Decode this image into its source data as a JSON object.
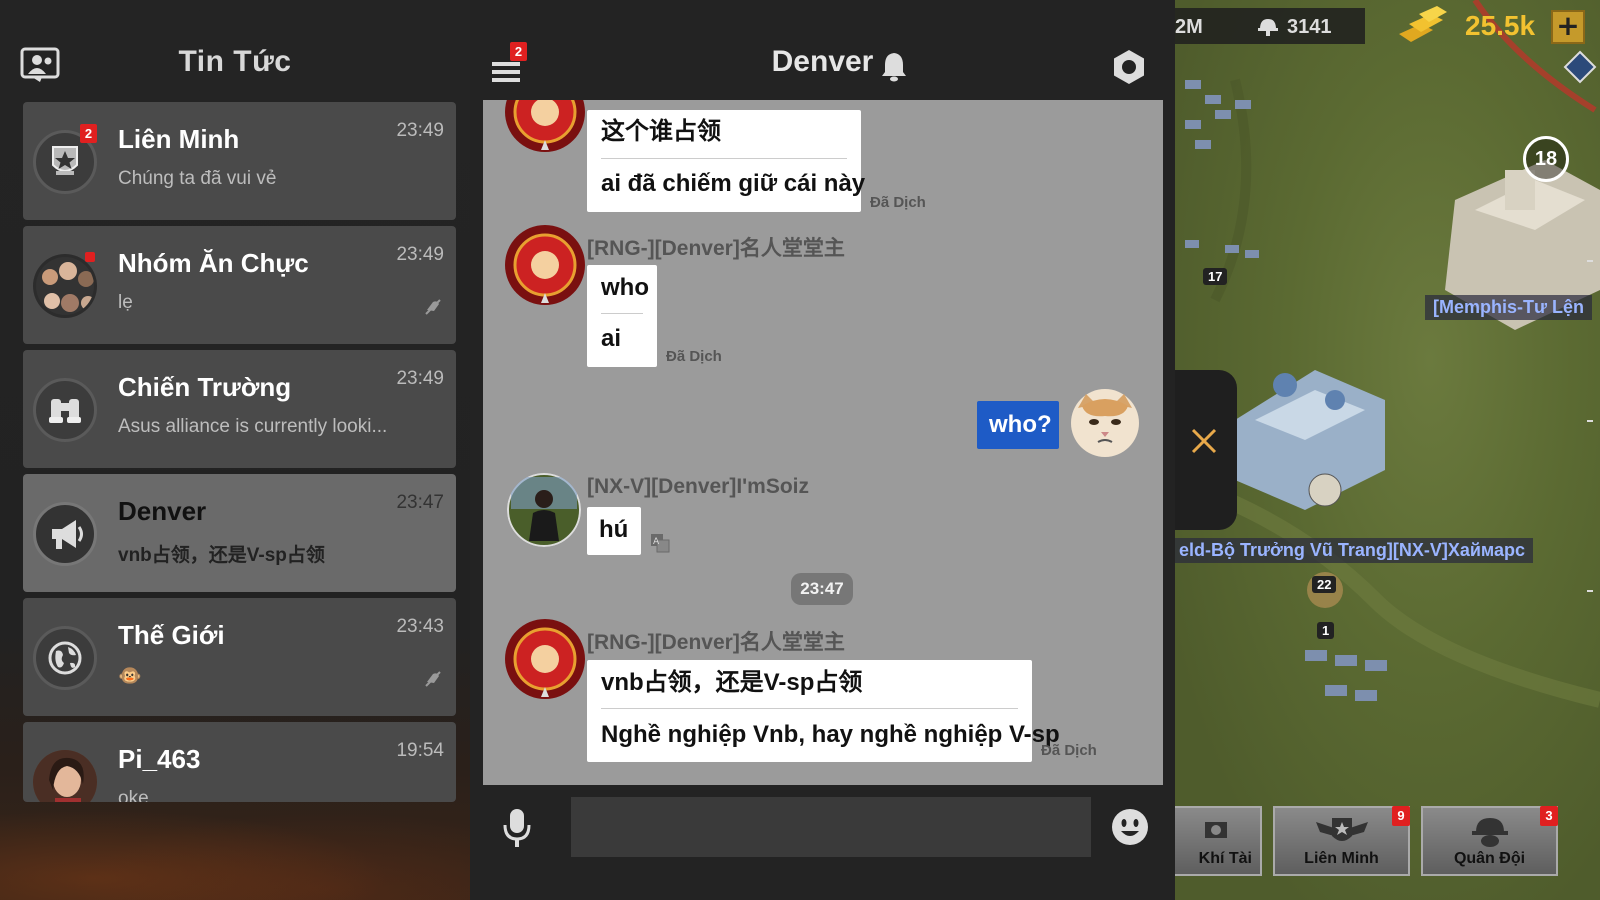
{
  "left_panel": {
    "title": "Tin Tức",
    "conversations": [
      {
        "name": "Liên Minh",
        "preview": "Chúng ta đã vui vẻ",
        "time": "23:49",
        "badge": "2"
      },
      {
        "name": "Nhóm Ăn Chực",
        "preview": "lẹ",
        "time": "23:49"
      },
      {
        "name": "Chiến Trường",
        "preview": "Asus alliance is currently looki...",
        "time": "23:49"
      },
      {
        "name": "Denver",
        "preview": "vnb占领，还是V-sp占领",
        "time": "23:47"
      },
      {
        "name": "Thế Giới",
        "preview": "🐵",
        "time": "23:43"
      },
      {
        "name": "Pi_463",
        "preview": "oke",
        "time": "19:54"
      }
    ]
  },
  "chat": {
    "title": "Denver",
    "menu_badge": "2",
    "messages": [
      {
        "lines": [
          "这个谁占领",
          "ai đã chiếm giữ cái này"
        ],
        "translated": "Đã Dịch"
      },
      {
        "sender": "[RNG-][Denver]名人堂堂主",
        "lines": [
          "who",
          "ai"
        ],
        "translated": "Đã Dịch"
      },
      {
        "own": true,
        "lines": [
          "who?"
        ]
      },
      {
        "sender": "[NX-V][Denver]I'mSoiz",
        "lines": [
          "hú"
        ]
      },
      {
        "sender": "[RNG-][Denver]名人堂堂主",
        "lines": [
          "vnb占领，还是V-sp占领",
          "Nghề nghiệp Vnb, hay nghề nghiệp V-sp"
        ],
        "translated": "Đã Dịch"
      }
    ],
    "time_divider": "23:47",
    "input_placeholder": ""
  },
  "map": {
    "resource_left": "2M",
    "power": "3141",
    "gold": "25.5k",
    "plus": "+",
    "age_rating": "18",
    "labels": [
      "[Memphis-Tư Lện",
      "eld-Bộ Trưởng Vũ Trang][NX-V]Хаймарс"
    ],
    "numbers": [
      "17",
      "22",
      "1"
    ],
    "bottom_buttons": [
      {
        "label": "Khí Tài"
      },
      {
        "label": "Liên Minh",
        "badge": "9"
      },
      {
        "label": "Quân Đội",
        "badge": "3"
      }
    ]
  },
  "colors": {
    "own_bubble": "#1e5bc6",
    "badge_red": "#e02020",
    "gold": "#f2c230"
  },
  "icons": [
    "contacts-icon",
    "menu-icon",
    "bell-icon",
    "hexagon-settings-icon",
    "microphone-icon",
    "smiley-icon",
    "close-x-icon",
    "mute-icon",
    "translate-icon",
    "gold-bars-icon",
    "helmet-icon"
  ]
}
